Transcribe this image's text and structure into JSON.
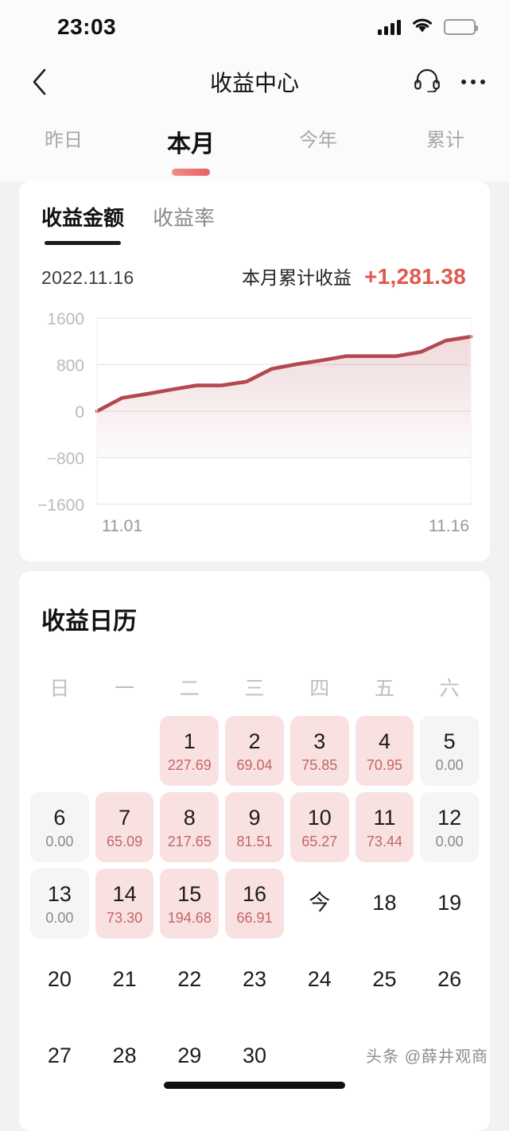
{
  "status_bar": {
    "time": "23:03",
    "signal_icon": "signal-bars-icon",
    "wifi_icon": "wifi-icon",
    "battery_icon": "battery-icon"
  },
  "nav": {
    "title": "收益中心",
    "back_icon": "back-chevron-icon",
    "support_icon": "headset-icon",
    "more_icon": "more-dots-icon"
  },
  "period_tabs": [
    {
      "label": "昨日",
      "active": false
    },
    {
      "label": "本月",
      "active": true
    },
    {
      "label": "今年",
      "active": false
    },
    {
      "label": "累计",
      "active": false
    }
  ],
  "sub_tabs": [
    {
      "label": "收益金额",
      "active": true
    },
    {
      "label": "收益率",
      "active": false
    }
  ],
  "summary": {
    "date": "2022.11.16",
    "label": "本月累计收益",
    "value": "+1,281.38"
  },
  "colors": {
    "accent_red": "#e1584f",
    "line": "#b5484f",
    "area_fill": "#fbe9e9",
    "cell_pink": "#fae1e1",
    "cell_gray": "#f6f4f4"
  },
  "chart_data": {
    "type": "area",
    "title": "",
    "xlabel": "",
    "ylabel": "",
    "ylim": [
      -1600,
      1600
    ],
    "yticks": [
      1600,
      800,
      0,
      -800,
      -1600
    ],
    "ytick_labels": [
      "1600",
      "800",
      "0",
      "−800",
      "−1600"
    ],
    "x_axis_labels": [
      "11.01",
      "11.16"
    ],
    "grid": true,
    "legend": "none",
    "x": [
      "11.01",
      "11.02",
      "11.03",
      "11.04",
      "11.05",
      "11.06",
      "11.07",
      "11.08",
      "11.09",
      "11.10",
      "11.11",
      "11.12",
      "11.13",
      "11.14",
      "11.15",
      "11.16"
    ],
    "series": [
      {
        "name": "本月累计收益",
        "values": [
          0,
          227.69,
          296.73,
          372.58,
          443.53,
          443.53,
          508.62,
          726.27,
          807.78,
          873.05,
          946.49,
          946.49,
          946.49,
          1019.79,
          1214.47,
          1281.38
        ]
      }
    ]
  },
  "calendar": {
    "title": "收益日历",
    "weekdays": [
      "日",
      "一",
      "二",
      "三",
      "四",
      "五",
      "六"
    ],
    "today_label": "今",
    "rows": [
      [
        {
          "day": "",
          "amount": "",
          "state": "empty"
        },
        {
          "day": "",
          "amount": "",
          "state": "empty"
        },
        {
          "day": "1",
          "amount": "227.69",
          "state": "has-value"
        },
        {
          "day": "2",
          "amount": "69.04",
          "state": "has-value"
        },
        {
          "day": "3",
          "amount": "75.85",
          "state": "has-value"
        },
        {
          "day": "4",
          "amount": "70.95",
          "state": "has-value"
        },
        {
          "day": "5",
          "amount": "0.00",
          "state": "zero"
        }
      ],
      [
        {
          "day": "6",
          "amount": "0.00",
          "state": "zero"
        },
        {
          "day": "7",
          "amount": "65.09",
          "state": "has-value"
        },
        {
          "day": "8",
          "amount": "217.65",
          "state": "has-value"
        },
        {
          "day": "9",
          "amount": "81.51",
          "state": "has-value"
        },
        {
          "day": "10",
          "amount": "65.27",
          "state": "has-value"
        },
        {
          "day": "11",
          "amount": "73.44",
          "state": "has-value"
        },
        {
          "day": "12",
          "amount": "0.00",
          "state": "zero"
        }
      ],
      [
        {
          "day": "13",
          "amount": "0.00",
          "state": "zero"
        },
        {
          "day": "14",
          "amount": "73.30",
          "state": "has-value"
        },
        {
          "day": "15",
          "amount": "194.68",
          "state": "has-value"
        },
        {
          "day": "16",
          "amount": "66.91",
          "state": "has-value"
        },
        {
          "day": "今",
          "amount": "",
          "state": "plain"
        },
        {
          "day": "18",
          "amount": "",
          "state": "plain"
        },
        {
          "day": "19",
          "amount": "",
          "state": "plain"
        }
      ],
      [
        {
          "day": "20",
          "amount": "",
          "state": "plain"
        },
        {
          "day": "21",
          "amount": "",
          "state": "plain"
        },
        {
          "day": "22",
          "amount": "",
          "state": "plain"
        },
        {
          "day": "23",
          "amount": "",
          "state": "plain"
        },
        {
          "day": "24",
          "amount": "",
          "state": "plain"
        },
        {
          "day": "25",
          "amount": "",
          "state": "plain"
        },
        {
          "day": "26",
          "amount": "",
          "state": "plain"
        }
      ],
      [
        {
          "day": "27",
          "amount": "",
          "state": "plain"
        },
        {
          "day": "28",
          "amount": "",
          "state": "plain"
        },
        {
          "day": "29",
          "amount": "",
          "state": "plain"
        },
        {
          "day": "30",
          "amount": "",
          "state": "plain"
        },
        {
          "day": "",
          "amount": "",
          "state": "empty"
        },
        {
          "day": "",
          "amount": "",
          "state": "empty"
        },
        {
          "day": "",
          "amount": "",
          "state": "empty"
        }
      ]
    ]
  },
  "watermark": "头条 @薛井观商"
}
